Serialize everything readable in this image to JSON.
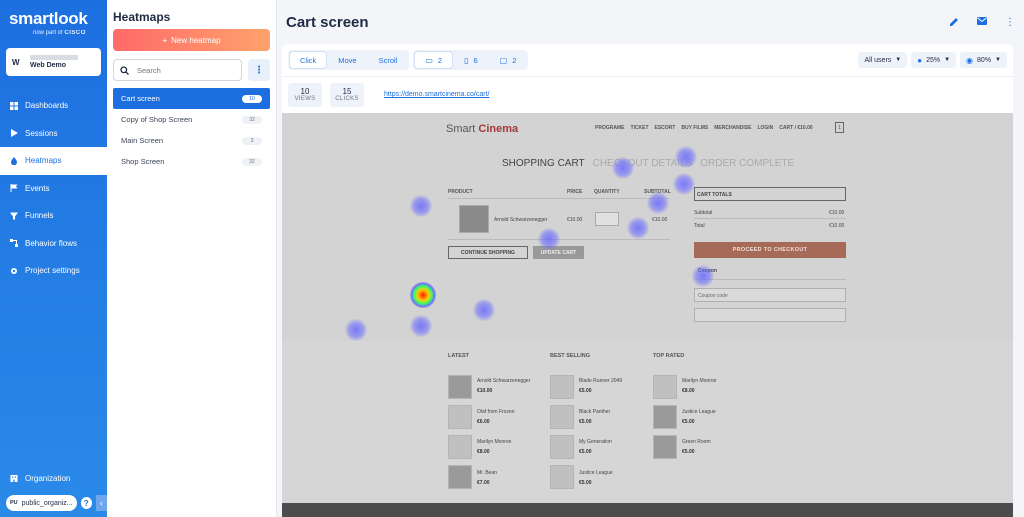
{
  "nav": {
    "logo": "smartlook",
    "logo_sub_prefix": "now part of",
    "logo_sub_brand": "CISCO",
    "project_initial": "W",
    "project_name": "Web Demo",
    "items": [
      {
        "label": "Dashboards",
        "icon": "dashboard-icon",
        "active": false
      },
      {
        "label": "Sessions",
        "icon": "play-icon",
        "active": false
      },
      {
        "label": "Heatmaps",
        "icon": "drop-icon",
        "active": true
      },
      {
        "label": "Events",
        "icon": "flag-icon",
        "active": false
      },
      {
        "label": "Funnels",
        "icon": "funnel-icon",
        "active": false
      },
      {
        "label": "Behavior flows",
        "icon": "flow-icon",
        "active": false
      },
      {
        "label": "Project settings",
        "icon": "gear-icon",
        "active": false
      }
    ],
    "organization_label": "Organization",
    "org_initials": "PU",
    "org_name": "public_organiz...",
    "help_label": "?"
  },
  "panel": {
    "title": "Heatmaps",
    "new_button": "New heatmap",
    "search_placeholder": "Search",
    "items": [
      {
        "label": "Cart screen",
        "count": "10",
        "active": true
      },
      {
        "label": "Copy of Shop Screen",
        "count": "32",
        "active": false
      },
      {
        "label": "Main Screen",
        "count": "3",
        "active": false
      },
      {
        "label": "Shop Screen",
        "count": "32",
        "active": false
      }
    ]
  },
  "main": {
    "title": "Cart screen",
    "tabs": [
      {
        "label": "Click",
        "active": true
      },
      {
        "label": "Move",
        "active": false
      },
      {
        "label": "Scroll",
        "active": false
      }
    ],
    "devices": [
      {
        "icon": "desktop-icon",
        "count": "2",
        "active": true
      },
      {
        "icon": "mobile-icon",
        "count": "6",
        "active": false
      },
      {
        "icon": "tablet-icon",
        "count": "2",
        "active": false
      }
    ],
    "filters": {
      "users": "All users",
      "intensity": "25%",
      "opacity": "80%"
    },
    "views_value": "10",
    "views_label": "VIEWS",
    "clicks_value": "15",
    "clicks_label": "CLICKS",
    "url": "https://demo.smartcinema.co/cart/"
  },
  "preview": {
    "logo_a": "Smart",
    "logo_b": "Cinema",
    "menu": [
      "PROGRAME",
      "TICKET",
      "ESCORT",
      "BUY FILMS",
      "MERCHANDISE",
      "LOGIN",
      "CART / €10.00"
    ],
    "cart_count": "1",
    "heading_1": "SHOPPING CART",
    "heading_2": "CHECKOUT DETAILS",
    "heading_3": "ORDER COMPLETE",
    "col_product": "PRODUCT",
    "col_price": "PRICE",
    "col_quantity": "QUANTITY",
    "col_subtotal": "SUBTOTAL",
    "product_name": "Arnold Schwarzenegger",
    "product_price": "€10.00",
    "product_subtotal": "€10.00",
    "continue_btn": "CONTINUE SHOPPING",
    "update_btn": "UPDATE CART",
    "cart_totals": "CART TOTALS",
    "subtotal_label": "Subtotal",
    "subtotal_value": "€10.00",
    "total_label": "Total",
    "total_value": "€10.00",
    "checkout_btn": "PROCEED TO CHECKOUT",
    "coupon_label": "Coupon",
    "coupon_placeholder": "Coupon code",
    "latest_title": "LATEST",
    "best_title": "BEST SELLING",
    "top_title": "TOP RATED",
    "latest": [
      {
        "name": "Arnold Schwarzenegger",
        "price": "€10.00"
      },
      {
        "name": "Olaf from Frozen",
        "price": "€6.00"
      },
      {
        "name": "Marilyn Monroe",
        "price": "€8.00"
      },
      {
        "name": "Mr. Bean",
        "price": "€7.00"
      }
    ],
    "best": [
      {
        "name": "Blade Runner 2049",
        "price": "€5.00"
      },
      {
        "name": "Black Panther",
        "price": "€5.00"
      },
      {
        "name": "My Generation",
        "price": "€5.00"
      },
      {
        "name": "Justice League",
        "price": "€5.00"
      }
    ],
    "top": [
      {
        "name": "Marilyn Monroe",
        "price": "€8.00"
      },
      {
        "name": "Justice League",
        "price": "€5.00"
      },
      {
        "name": "Green Room",
        "price": "€5.00"
      }
    ]
  },
  "colors": {
    "brand_blue": "#1d6fe0",
    "new_heatmap_gradient_start": "#ff6a6a",
    "new_heatmap_gradient_end": "#ffa26b"
  }
}
